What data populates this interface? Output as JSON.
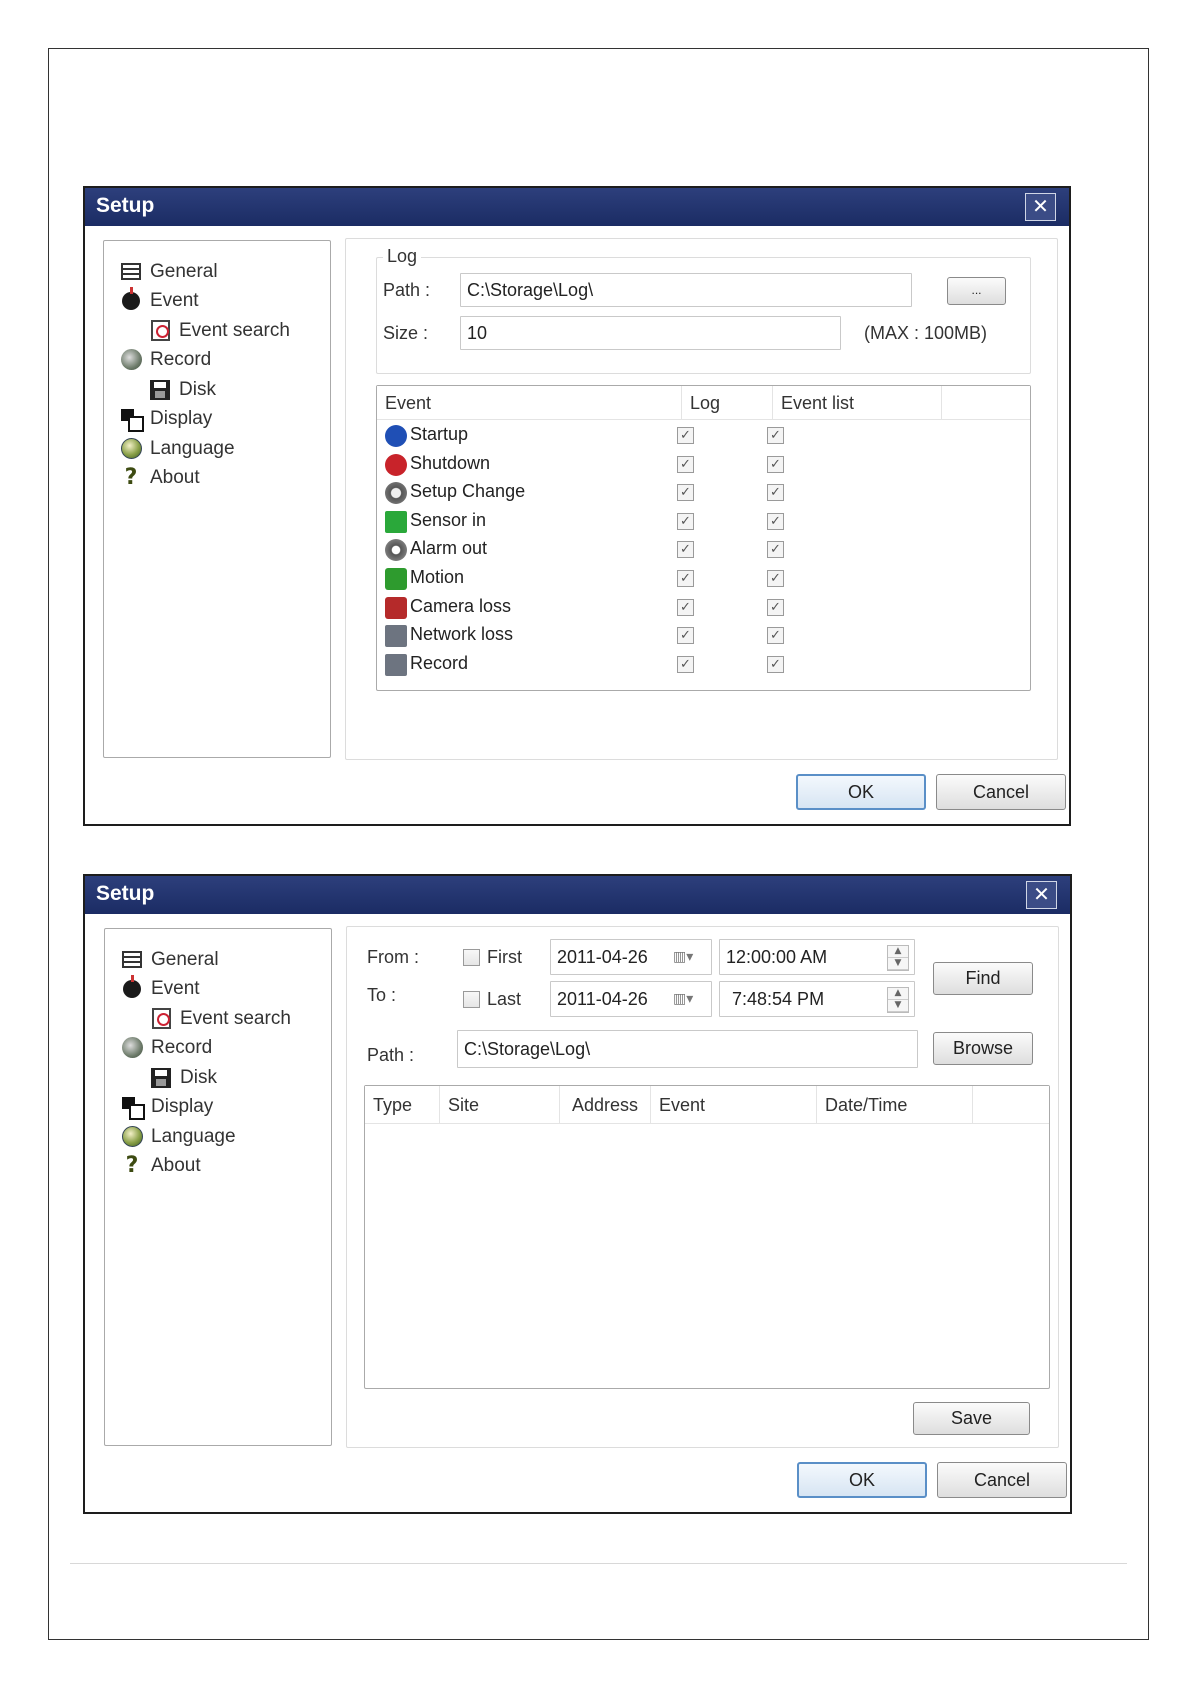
{
  "dialogs": [
    {
      "title": "Setup",
      "close_glyph": "✕",
      "tree": [
        {
          "label": "General",
          "icon": "general-icon"
        },
        {
          "label": "Event",
          "icon": "event-icon"
        },
        {
          "label": "Event search",
          "icon": "event-search-icon"
        },
        {
          "label": "Record",
          "icon": "record-icon"
        },
        {
          "label": "Disk",
          "icon": "disk-icon"
        },
        {
          "label": "Display",
          "icon": "display-icon"
        },
        {
          "label": "Language",
          "icon": "language-icon"
        },
        {
          "label": "About",
          "icon": "about-icon"
        }
      ],
      "log_group": {
        "legend": "Log",
        "path_label": "Path :",
        "path_value": "C:\\Storage\\Log\\",
        "browse_label": "...",
        "size_label": "Size :",
        "size_value": "10",
        "max_note": "(MAX : 100MB)"
      },
      "event_table": {
        "headers": [
          "Event",
          "Log",
          "Event list"
        ],
        "rows": [
          {
            "name": "Startup",
            "icon": "info-icon",
            "log": true,
            "event_list": true
          },
          {
            "name": "Shutdown",
            "icon": "shutdown-icon",
            "log": true,
            "event_list": true
          },
          {
            "name": "Setup Change",
            "icon": "setup-change-icon",
            "log": true,
            "event_list": true
          },
          {
            "name": "Sensor in",
            "icon": "sensor-in-icon",
            "log": true,
            "event_list": true
          },
          {
            "name": "Alarm out",
            "icon": "alarm-out-icon",
            "log": true,
            "event_list": true
          },
          {
            "name": "Motion",
            "icon": "motion-icon",
            "log": true,
            "event_list": true
          },
          {
            "name": "Camera loss",
            "icon": "camera-loss-icon",
            "log": true,
            "event_list": true
          },
          {
            "name": "Network loss",
            "icon": "network-loss-icon",
            "log": true,
            "event_list": true
          },
          {
            "name": "Record",
            "icon": "record-event-icon",
            "log": true,
            "event_list": true
          }
        ]
      },
      "ok_label": "OK",
      "cancel_label": "Cancel"
    },
    {
      "title": "Setup",
      "close_glyph": "✕",
      "tree": [
        {
          "label": "General",
          "icon": "general-icon"
        },
        {
          "label": "Event",
          "icon": "event-icon"
        },
        {
          "label": "Event search",
          "icon": "event-search-icon"
        },
        {
          "label": "Record",
          "icon": "record-icon"
        },
        {
          "label": "Disk",
          "icon": "disk-icon"
        },
        {
          "label": "Display",
          "icon": "display-icon"
        },
        {
          "label": "Language",
          "icon": "language-icon"
        },
        {
          "label": "About",
          "icon": "about-icon"
        }
      ],
      "search": {
        "from_label": "From :",
        "to_label": "To :",
        "first_label": "First",
        "last_label": "Last",
        "first_checked": false,
        "last_checked": false,
        "from_date": "2011-04-26",
        "to_date": "2011-04-26",
        "from_time": "12:00:00 AM",
        "to_time": "7:48:54 PM",
        "find_label": "Find",
        "path_label": "Path :",
        "path_value": "C:\\Storage\\Log\\",
        "browse_label": "Browse",
        "headers": [
          "Type",
          "Site",
          "Address",
          "Event",
          "Date/Time"
        ],
        "save_label": "Save"
      },
      "ok_label": "OK",
      "cancel_label": "Cancel"
    }
  ]
}
